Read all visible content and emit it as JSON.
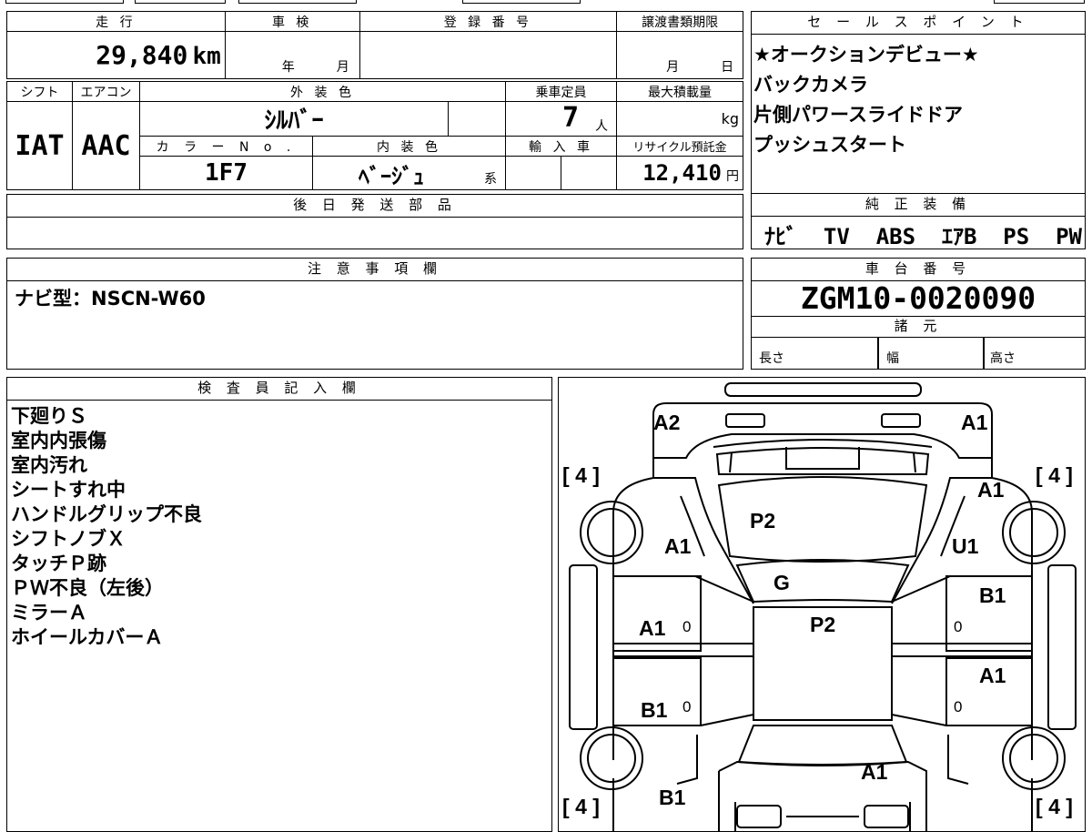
{
  "top_grid": {
    "labels": {
      "mileage": "走 行",
      "inspection": "車 検",
      "registration": "登 録 番 号",
      "transfer_deadline": "譲渡書類期限",
      "shift": "シフト",
      "aircon": "エアコン",
      "exterior_color": "外 装 色",
      "capacity": "乗車定員",
      "max_load": "最大積載量",
      "color_no": "カ ラ ー N o .",
      "interior_color": "内 装 色",
      "import": "輸 入 車",
      "recycle": "リサイクル預託金"
    },
    "values": {
      "mileage": "29,840",
      "mileage_unit": "km",
      "inspection_year_unit": "年",
      "inspection_month_unit": "月",
      "deadline_month_unit": "月",
      "deadline_day_unit": "日",
      "shift": "IAT",
      "aircon": "AAC",
      "exterior_color": "ｼﾙﾊﾞｰ",
      "capacity": "7",
      "capacity_unit": "人",
      "max_load_unit": "kg",
      "color_no": "1F7",
      "interior_color": "ﾍﾞｰｼﾞｭ",
      "interior_suffix": "系",
      "recycle": "12,410",
      "recycle_unit": "円"
    },
    "later_parts_label": "後 日 発 送 部 品"
  },
  "sales_points": {
    "title": "セ ー ル ス ポ イ ン ト",
    "items": [
      "★オークションデビュー★",
      "バックカメラ",
      "片側パワースライドドア",
      "プッシュスタート"
    ]
  },
  "genuine_equipment": {
    "title": "純 正 装 備",
    "value": "ﾅﾋﾞ  TV  ABS  ｴｱB  PS  PW"
  },
  "notes": {
    "title": "注 意 事 項 欄",
    "text": "ナビ型：NSCN-W60"
  },
  "chassis": {
    "title": "車 台 番 号",
    "number": "ZGM10-0020090",
    "spec_title": "諸 元",
    "length": "長さ",
    "width": "幅",
    "height": "高さ"
  },
  "inspector": {
    "title": "検 査 員 記 入 欄",
    "lines": [
      "下廻りＳ",
      "室内内張傷",
      "室内汚れ",
      "シートすれ中",
      "ハンドルグリップ不良",
      "シフトノブＸ",
      "タッチＰ跡",
      "ＰＷ不良（左後）",
      "ミラーＡ",
      "ホイールカバーＡ"
    ]
  },
  "diagram": {
    "tire_tread": "4",
    "tread_left": "[",
    "tread_right": "]",
    "zero": "0",
    "marks": {
      "front_left": "A2",
      "front_right": "A1",
      "hood": "P2",
      "fender_left": "A1",
      "fender_right": "U1",
      "fender_right_top": "A1",
      "windshield": "G",
      "roof": "P2",
      "front_door_left": "A1",
      "rear_door_left": "B1",
      "front_door_right": "B1",
      "rear_door_right": "A1",
      "rear_quarter_left": "B1",
      "back_door": "A1"
    }
  }
}
